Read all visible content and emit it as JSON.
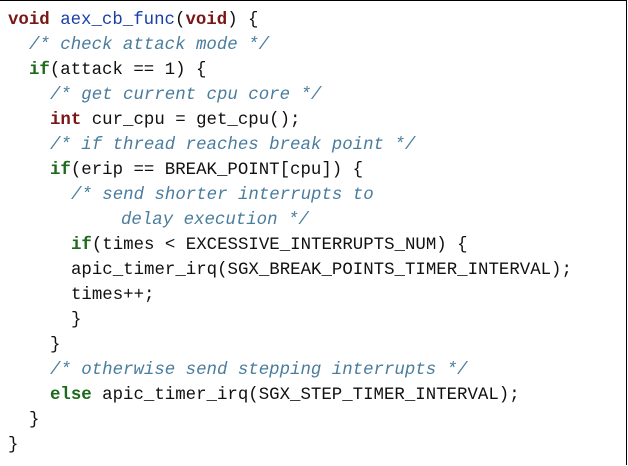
{
  "code": {
    "l1": {
      "kw": "void",
      "fn": "aex_cb_func",
      "p_open": "(",
      "kw2": "void",
      "rest": ") {"
    },
    "l2": {
      "comment": "/* check attack mode */"
    },
    "l3": {
      "kw": "if",
      "rest": "(attack == 1) {"
    },
    "l4": {
      "comment": "/* get current cpu core */"
    },
    "l5": {
      "kw": "int",
      "rest": " cur_cpu = get_cpu();"
    },
    "l6": {
      "comment": "/* if thread reaches break point */"
    },
    "l7": {
      "kw": "if",
      "rest": "(erip == BREAK_POINT[cpu]) {"
    },
    "l8": {
      "comment": "/* send shorter interrupts to"
    },
    "l9": {
      "comment": "delay execution */"
    },
    "l10": {
      "kw": "if",
      "rest": "(times < EXCESSIVE_INTERRUPTS_NUM) {"
    },
    "l11": {
      "text": "apic_timer_irq(SGX_BREAK_POINTS_TIMER_INTERVAL);"
    },
    "l12": {
      "text": "times++;"
    },
    "l13": {
      "text": "}"
    },
    "l14": {
      "text": "}"
    },
    "l15": {
      "comment": "/* otherwise send stepping interrupts */"
    },
    "l16": {
      "kw": "else",
      "rest": " apic_timer_irq(SGX_STEP_TIMER_INTERVAL);"
    },
    "l17": {
      "text": "}"
    },
    "l18": {
      "text": "}"
    }
  },
  "colors": {
    "type_keyword": "#7a1616",
    "control_keyword": "#1d6a1d",
    "function_name": "#1a3fa8",
    "comment": "#4a7d9d",
    "text": "#111111"
  }
}
